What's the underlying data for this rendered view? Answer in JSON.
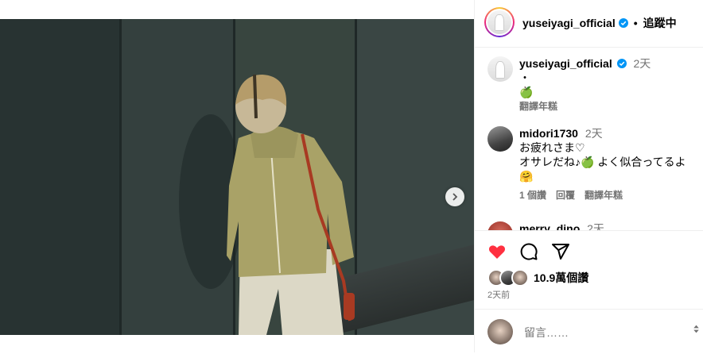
{
  "post": {
    "dots_count": 4,
    "active_dot": 0
  },
  "header": {
    "username": "yuseiyagi_official",
    "separator": "•",
    "follow_label": "追蹤中"
  },
  "comments": [
    {
      "username": "yuseiyagi_official",
      "time": "2天",
      "lines": [
        "・",
        "🍏"
      ],
      "translate": "翻譯年糕"
    },
    {
      "username": "midori1730",
      "time": "2天",
      "lines": [
        "お疲れさま♡",
        "オサレだね♪🍏 よく似合ってるよ",
        "🤗"
      ],
      "likes": "1 個讚",
      "reply": "回覆",
      "translate": "翻譯年糕"
    },
    {
      "username": "merry_dino",
      "time": "2天"
    }
  ],
  "actions": {
    "like_icon": "heart-filled-icon",
    "comment_icon": "comment-icon",
    "share_icon": "share-icon",
    "like_color": "#ff3040",
    "likes_text": "10.9萬個讚",
    "post_time": "2天前"
  },
  "add_comment": {
    "placeholder": "留言……",
    "emoji_icon": "emoji-icon"
  },
  "colors": {
    "verified": "#0095f6",
    "secondary_text": "#737373",
    "wall": "#2f3a39"
  }
}
